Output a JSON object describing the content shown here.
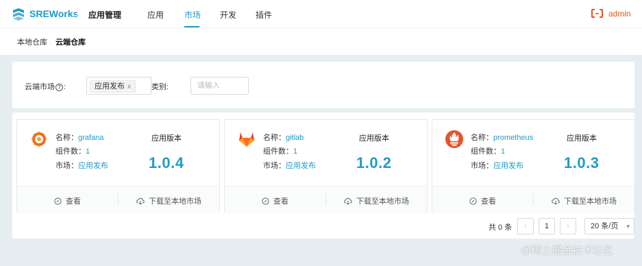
{
  "header": {
    "brand": "SREWorks",
    "app_name": "应用管理",
    "nav": [
      {
        "label": "应用",
        "active": false
      },
      {
        "label": "市场",
        "active": true
      },
      {
        "label": "开发",
        "active": false
      },
      {
        "label": "插件",
        "active": false
      }
    ],
    "user": "admin",
    "brand_color": "#1e9bc8",
    "user_color": "#e5531a"
  },
  "subnav": {
    "items": [
      {
        "label": "本地仓库",
        "active": false
      },
      {
        "label": "云端仓库",
        "active": true
      }
    ]
  },
  "filters": {
    "market_label_prefix": "云端市场",
    "help_icon": "?",
    "market_label_suffix": ":",
    "market_tag": "应用发布",
    "tag_close": "x",
    "category_label": "类别:",
    "category_placeholder": "请输入"
  },
  "cards": [
    {
      "icon": "grafana-icon",
      "name_label": "名称：",
      "name": "grafana",
      "components_label": "组件数：",
      "components": "1",
      "market_label": "市场：",
      "market": "应用发布",
      "version_label": "应用版本",
      "version": "1.0.4",
      "view_label": "查看",
      "download_label": "下载至本地市场"
    },
    {
      "icon": "gitlab-icon",
      "name_label": "名称：",
      "name": "gitlab",
      "components_label": "组件数：",
      "components": "1",
      "market_label": "市场：",
      "market": "应用发布",
      "version_label": "应用版本",
      "version": "1.0.2",
      "view_label": "查看",
      "download_label": "下载至本地市场"
    },
    {
      "icon": "prometheus-icon",
      "name_label": "名称：",
      "name": "prometheus",
      "components_label": "组件数：",
      "components": "1",
      "market_label": "市场：",
      "market": "应用发布",
      "version_label": "应用版本",
      "version": "1.0.3",
      "view_label": "查看",
      "download_label": "下载至本地市场"
    }
  ],
  "pagination": {
    "total": "共 0 条",
    "prev": "‹",
    "page": "1",
    "next": "›",
    "page_size": "20 条/页"
  },
  "watermark": "@稀土掘金技术社区"
}
